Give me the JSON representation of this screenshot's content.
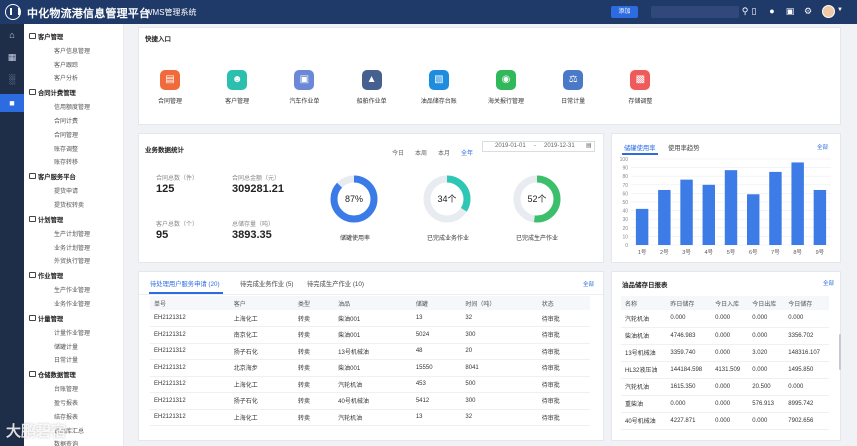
{
  "header": {
    "app_title": "中化物流港信息管理平台",
    "app_sub": "WMS管理系统",
    "add_label": "添加"
  },
  "icons": {
    "logo": "logo-icon",
    "search": "search-icon",
    "mobile": "mobile-icon",
    "notify": "bell-icon",
    "help": "help-icon",
    "settings": "settings-icon",
    "user": "user-icon"
  },
  "rail": [
    "home-icon",
    "grid-icon",
    "chart-icon",
    "message-icon"
  ],
  "sidebar": [
    {
      "group": "客户管理",
      "items": [
        "客户信息管理",
        "客户跟踪",
        "客户分析"
      ]
    },
    {
      "group": "合同计费管理",
      "items": [
        "信用额度管理",
        "合同计费",
        "合同管理",
        "账存调整",
        "账存转移"
      ]
    },
    {
      "group": "客户服务平台",
      "items": [
        "提货申请",
        "提货权转卖"
      ]
    },
    {
      "group": "计划管理",
      "items": [
        "生产计划管理",
        "业务计划管理",
        "外贸执行管理"
      ]
    },
    {
      "group": "作业管理",
      "items": [
        "生产作业管理",
        "业务作业管理"
      ]
    },
    {
      "group": "计量管理",
      "items": [
        "计量作业管理",
        "储罐计量",
        "日常计量"
      ]
    },
    {
      "group": "仓储数据管理",
      "items": [
        "台账管理",
        "盈亏报表",
        "结存报表",
        "进出库汇总",
        "数据查询"
      ]
    }
  ],
  "quick": {
    "title": "快捷入口",
    "items": [
      {
        "label": "合同管理",
        "color": "#f06a3c",
        "icon": "contract-icon"
      },
      {
        "label": "客户管理",
        "color": "#2bbfae",
        "icon": "customer-icon"
      },
      {
        "label": "汽车作业单",
        "color": "#6b88d6",
        "icon": "car-icon"
      },
      {
        "label": "船舶作业单",
        "color": "#46618f",
        "icon": "ship-icon"
      },
      {
        "label": "油品储存台账",
        "color": "#1e8de0",
        "icon": "ledger-icon"
      },
      {
        "label": "海关报行管理",
        "color": "#30b85a",
        "icon": "customs-icon"
      },
      {
        "label": "日常计量",
        "color": "#4a79c7",
        "icon": "scale-icon"
      },
      {
        "label": "存储调整",
        "color": "#ef5a5a",
        "icon": "storage-icon"
      }
    ]
  },
  "stats": {
    "title": "业务数据统计",
    "tabs": [
      "今日",
      "本周",
      "本月",
      "全年"
    ],
    "date_from": "2019-01-01",
    "date_sep": "-",
    "date_to": "2019-12-31",
    "items": [
      {
        "label": "合同总数（件）",
        "value": "125"
      },
      {
        "label": "合同总金额（元）",
        "value": "309281.21"
      },
      {
        "label": "客户总数（个）",
        "value": "95"
      },
      {
        "label": "总储存量（吨）",
        "value": "3893.35"
      }
    ],
    "rings": [
      {
        "value": "87%",
        "pct": 87,
        "label": "储罐使用率",
        "color": "#3a7be8"
      },
      {
        "value": "34个",
        "pct": 34,
        "label": "已完成业务作业",
        "color": "#2ec7b5"
      },
      {
        "value": "52个",
        "pct": 52,
        "label": "已完成生产作业",
        "color": "#3bbf6a"
      }
    ]
  },
  "tank": {
    "tabs": [
      "储罐使用率",
      "使用率趋势"
    ],
    "more": "全部"
  },
  "chart_data": {
    "type": "bar",
    "categories": [
      "1号",
      "2号",
      "3号",
      "4号",
      "5号",
      "6号",
      "7号",
      "8号",
      "9号"
    ],
    "values": [
      42,
      64,
      76,
      70,
      87,
      59,
      85,
      96,
      64
    ],
    "ylim": [
      0,
      100
    ],
    "yticks": [
      0,
      10,
      20,
      30,
      40,
      50,
      60,
      70,
      80,
      90,
      100
    ],
    "color": "#3d7be6",
    "grid": true
  },
  "tasks": {
    "tabs": [
      "待处理用户服务申请 (20)",
      "待完成业务作业 (5)",
      "待完成生产作业 (10)"
    ],
    "more": "全部",
    "columns": [
      "单号",
      "客户",
      "类型",
      "油品",
      "储罐",
      "时间（吨）",
      "状态"
    ],
    "rows": [
      [
        "EH2121312",
        "上海化工",
        "转卖",
        "柴油001",
        "13",
        "32",
        "待审批"
      ],
      [
        "EH2121312",
        "南京化工",
        "转卖",
        "柴油001",
        "5024",
        "300",
        "待审批"
      ],
      [
        "EH2121312",
        "扬子石化",
        "转卖",
        "13号机械油",
        "48",
        "20",
        "待审批"
      ],
      [
        "EH2121312",
        "北京海步",
        "转卖",
        "柴油001",
        "15550",
        "8041",
        "待审批"
      ],
      [
        "EH2121312",
        "上海化工",
        "转卖",
        "汽轮机油",
        "453",
        "500",
        "待审批"
      ],
      [
        "EH2121312",
        "扬子石化",
        "转卖",
        "40号机械油",
        "5412",
        "300",
        "待审批"
      ],
      [
        "EH2121312",
        "上海化工",
        "转卖",
        "汽轮机油",
        "13",
        "32",
        "待审批"
      ]
    ]
  },
  "inventory": {
    "title": "油品储存日报表",
    "more": "全部",
    "columns": [
      "名称",
      "昨日储存",
      "今日入库",
      "今日出库",
      "今日储存"
    ],
    "rows": [
      [
        "汽轮机油",
        "0.000",
        "0.000",
        "0.000",
        "0.000"
      ],
      [
        "柴油机油",
        "4746.983",
        "0.000",
        "0.000",
        "3356.702"
      ],
      [
        "13号机械油",
        "3359.740",
        "0.000",
        "3.020",
        "148316.107"
      ],
      [
        "HL32液压油",
        "144184.598",
        "4131.509",
        "0.000",
        "1495.850"
      ],
      [
        "汽轮机油",
        "1615.350",
        "0.000",
        "20.500",
        "0.000"
      ],
      [
        "重柴油",
        "0.000",
        "0.000",
        "576.913",
        "8995.742"
      ],
      [
        "40号机械油",
        "4227.871",
        "0.000",
        "0.000",
        "7902.656"
      ]
    ]
  },
  "watermark": "大鹏碧宿"
}
